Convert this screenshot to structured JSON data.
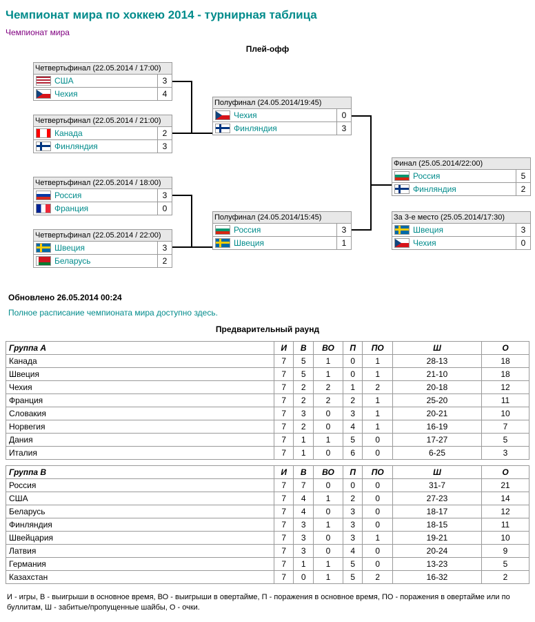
{
  "title": "Чемпионат мира по хоккею 2014 - турнирная таблица",
  "subtitle": "Чемпионат мира",
  "playoff_title": "Плей-офф",
  "prelim_title": "Предварительный раунд",
  "updated": "Обновлено 26.05.2014 00:24",
  "schedule_link": "Полное расписание чемпионата мира доступно здесь.",
  "matches": {
    "qf1": {
      "header": "Четвертьфинал (22.05.2014 / 17:00)",
      "t1": "США",
      "s1": "3",
      "f1": "fl-usa",
      "t2": "Чехия",
      "s2": "4",
      "f2": "fl-cze"
    },
    "qf2": {
      "header": "Четвертьфинал (22.05.2014 / 21:00)",
      "t1": "Канада",
      "s1": "2",
      "f1": "fl-can",
      "t2": "Финляндия",
      "s2": "3",
      "f2": "fl-fin"
    },
    "qf3": {
      "header": "Четвертьфинал (22.05.2014 / 18:00)",
      "t1": "Россия",
      "s1": "3",
      "f1": "fl-rus",
      "t2": "Франция",
      "s2": "0",
      "f2": "fl-fra"
    },
    "qf4": {
      "header": "Четвертьфинал (22.05.2014 / 22:00)",
      "t1": "Швеция",
      "s1": "3",
      "f1": "fl-swe",
      "t2": "Беларусь",
      "s2": "2",
      "f2": "fl-blr"
    },
    "sf1": {
      "header": "Полуфинал (24.05.2014/19:45)",
      "t1": "Чехия",
      "s1": "0",
      "f1": "fl-cze",
      "t2": "Финляндия",
      "s2": "3",
      "f2": "fl-fin"
    },
    "sf2": {
      "header": "Полуфинал (24.05.2014/15:45)",
      "t1": "Россия",
      "s1": "3",
      "f1": "fl-bul",
      "t2": "Швеция",
      "s2": "1",
      "f2": "fl-swe"
    },
    "final": {
      "header": "Финал (25.05.2014/22:00)",
      "t1": "Россия",
      "s1": "5",
      "f1": "fl-bul",
      "t2": "Финляндия",
      "s2": "2",
      "f2": "fl-fin"
    },
    "third": {
      "header": "За 3-е место (25.05.2014/17:30)",
      "t1": "Швеция",
      "s1": "3",
      "f1": "fl-swe",
      "t2": "Чехия",
      "s2": "0",
      "f2": "fl-cze"
    }
  },
  "headers": {
    "grp": "",
    "g": "И",
    "w": "В",
    "wo": "ВО",
    "l": "П",
    "lo": "ПО",
    "gd": "Ш",
    "pts": "О"
  },
  "groupA_name": "Группа A",
  "groupB_name": "Группа B",
  "groupA": [
    {
      "name": "Канада",
      "g": "7",
      "w": "5",
      "wo": "1",
      "l": "0",
      "lo": "1",
      "gd": "28-13",
      "pts": "18"
    },
    {
      "name": "Швеция",
      "g": "7",
      "w": "5",
      "wo": "1",
      "l": "0",
      "lo": "1",
      "gd": "21-10",
      "pts": "18"
    },
    {
      "name": "Чехия",
      "g": "7",
      "w": "2",
      "wo": "2",
      "l": "1",
      "lo": "2",
      "gd": "20-18",
      "pts": "12"
    },
    {
      "name": "Франция",
      "g": "7",
      "w": "2",
      "wo": "2",
      "l": "2",
      "lo": "1",
      "gd": "25-20",
      "pts": "11"
    },
    {
      "name": "Словакия",
      "g": "7",
      "w": "3",
      "wo": "0",
      "l": "3",
      "lo": "1",
      "gd": "20-21",
      "pts": "10"
    },
    {
      "name": "Норвегия",
      "g": "7",
      "w": "2",
      "wo": "0",
      "l": "4",
      "lo": "1",
      "gd": "16-19",
      "pts": "7"
    },
    {
      "name": "Дания",
      "g": "7",
      "w": "1",
      "wo": "1",
      "l": "5",
      "lo": "0",
      "gd": "17-27",
      "pts": "5"
    },
    {
      "name": "Италия",
      "g": "7",
      "w": "1",
      "wo": "0",
      "l": "6",
      "lo": "0",
      "gd": "6-25",
      "pts": "3"
    }
  ],
  "groupB": [
    {
      "name": "Россия",
      "g": "7",
      "w": "7",
      "wo": "0",
      "l": "0",
      "lo": "0",
      "gd": "31-7",
      "pts": "21"
    },
    {
      "name": "США",
      "g": "7",
      "w": "4",
      "wo": "1",
      "l": "2",
      "lo": "0",
      "gd": "27-23",
      "pts": "14"
    },
    {
      "name": "Беларусь",
      "g": "7",
      "w": "4",
      "wo": "0",
      "l": "3",
      "lo": "0",
      "gd": "18-17",
      "pts": "12"
    },
    {
      "name": "Финляндия",
      "g": "7",
      "w": "3",
      "wo": "1",
      "l": "3",
      "lo": "0",
      "gd": "18-15",
      "pts": "11"
    },
    {
      "name": "Швейцария",
      "g": "7",
      "w": "3",
      "wo": "0",
      "l": "3",
      "lo": "1",
      "gd": "19-21",
      "pts": "10"
    },
    {
      "name": "Латвия",
      "g": "7",
      "w": "3",
      "wo": "0",
      "l": "4",
      "lo": "0",
      "gd": "20-24",
      "pts": "9"
    },
    {
      "name": "Германия",
      "g": "7",
      "w": "1",
      "wo": "1",
      "l": "5",
      "lo": "0",
      "gd": "13-23",
      "pts": "5"
    },
    {
      "name": "Казахстан",
      "g": "7",
      "w": "0",
      "wo": "1",
      "l": "5",
      "lo": "2",
      "gd": "16-32",
      "pts": "2"
    }
  ],
  "legend": "И - игры, В - выигрыши в основное время, ВО - выигрыши в овертайме, П - поражения в основное время, ПО - поражения в овертайме или по буллитам, Ш - забитые/пропущенные шайбы, О - очки."
}
